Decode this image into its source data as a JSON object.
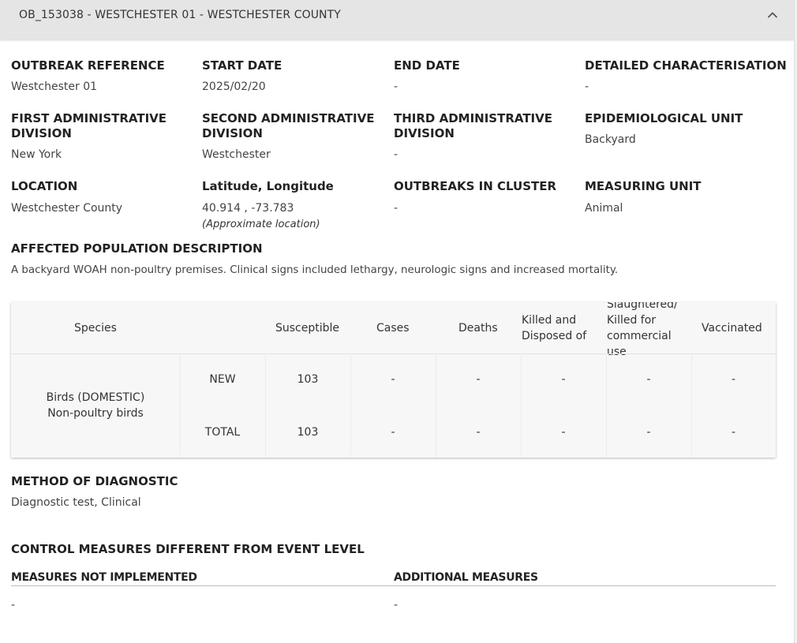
{
  "header": {
    "title": "OB_153038 - WESTCHESTER 01 - WESTCHESTER COUNTY",
    "collapse_icon": "chevron-up-icon"
  },
  "fields": {
    "outbreak_reference": {
      "label": "OUTBREAK REFERENCE",
      "value": "Westchester 01"
    },
    "start_date": {
      "label": "START DATE",
      "value": "2025/02/20"
    },
    "end_date": {
      "label": "END DATE",
      "value": "-"
    },
    "detailed_characterisation": {
      "label": "DETAILED CHARACTERISATION",
      "value": "-"
    },
    "first_admin": {
      "label_line1": "FIRST ADMINISTRATIVE",
      "label_line2": "DIVISION",
      "value": "New York"
    },
    "second_admin": {
      "label_line1": "SECOND ADMINISTRATIVE",
      "label_line2": "DIVISION",
      "value": "Westchester"
    },
    "third_admin": {
      "label_line1": "THIRD ADMINISTRATIVE",
      "label_line2": "DIVISION",
      "value": "-"
    },
    "epi_unit": {
      "label": "EPIDEMIOLOGICAL UNIT",
      "value": "Backyard"
    },
    "location": {
      "label": "LOCATION",
      "value": "Westchester County"
    },
    "lat_long": {
      "label": "Latitude, Longitude",
      "value": "40.914 , -73.783",
      "note": "(Approximate location)"
    },
    "outbreaks_cluster": {
      "label": "OUTBREAKS IN CLUSTER",
      "value": "-"
    },
    "measuring_unit": {
      "label": "MEASURING UNIT",
      "value": "Animal"
    },
    "affected_population": {
      "label": "AFFECTED POPULATION DESCRIPTION",
      "value": "A backyard WOAH non-poultry premises. Clinical signs included lethargy, neurologic signs and increased mortality."
    }
  },
  "table": {
    "headers": {
      "species": "Species",
      "susceptible": "Susceptible",
      "cases": "Cases",
      "deaths": "Deaths",
      "killed_line1": "Killed and",
      "killed_line2": "Disposed of",
      "slaughtered_line1": "Slaughtered/",
      "slaughtered_line2": "Killed for",
      "slaughtered_line3": "commercial",
      "slaughtered_line4": "use",
      "vaccinated": "Vaccinated"
    },
    "species_line1": "Birds (DOMESTIC)",
    "species_line2": "Non-poultry birds",
    "rows": [
      {
        "type": "NEW",
        "susceptible": "103",
        "cases": "-",
        "deaths": "-",
        "killed": "-",
        "slaughtered": "-",
        "vaccinated": "-"
      },
      {
        "type": "TOTAL",
        "susceptible": "103",
        "cases": "-",
        "deaths": "-",
        "killed": "-",
        "slaughtered": "-",
        "vaccinated": "-"
      }
    ]
  },
  "diagnostic": {
    "label": "METHOD OF DIAGNOSTIC",
    "value": "Diagnostic test, Clinical"
  },
  "control": {
    "title": "CONTROL MEASURES DIFFERENT FROM EVENT LEVEL",
    "not_implemented_label": "MEASURES NOT IMPLEMENTED",
    "not_implemented_value": "-",
    "additional_label": "ADDITIONAL MEASURES",
    "additional_value": "-"
  }
}
